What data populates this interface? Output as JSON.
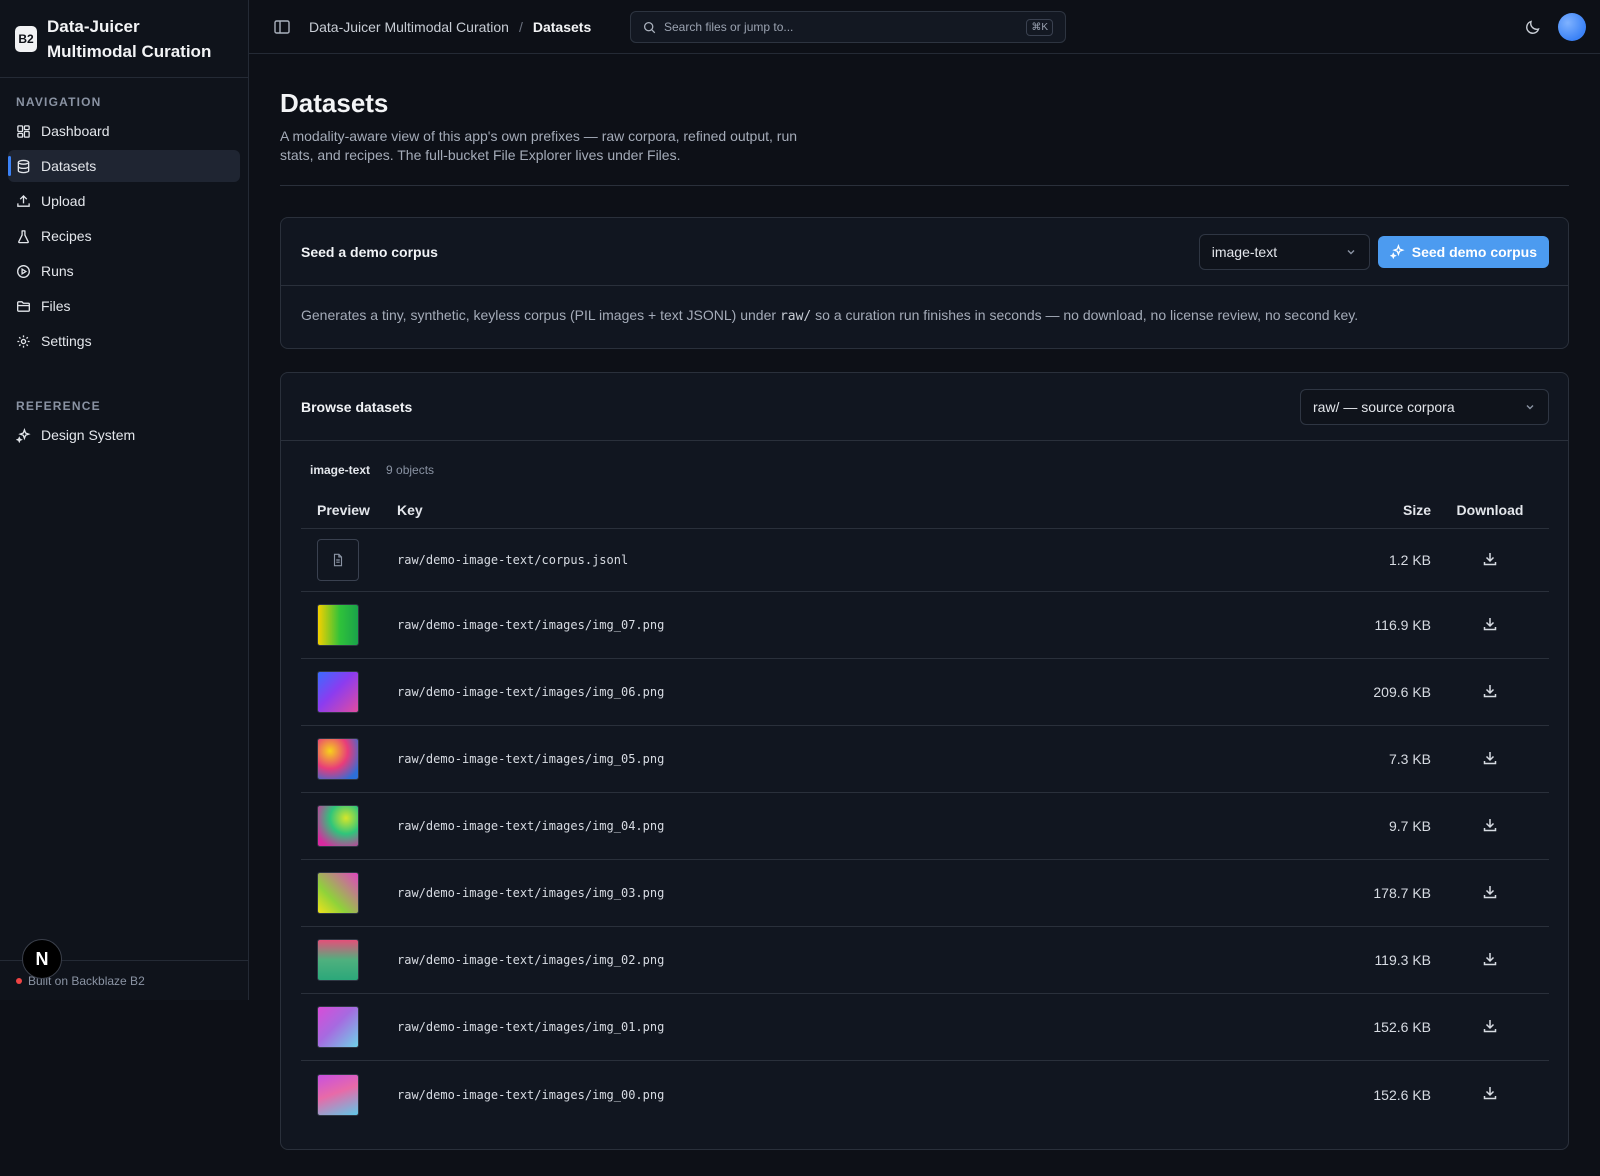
{
  "app": {
    "logo_text": "B2",
    "title": "Data-Juicer Multimodal Curation"
  },
  "sidebar": {
    "nav_label": "NAVIGATION",
    "items": [
      {
        "label": "Dashboard",
        "icon": "dashboard-icon"
      },
      {
        "label": "Datasets",
        "icon": "database-icon",
        "active": true
      },
      {
        "label": "Upload",
        "icon": "upload-icon"
      },
      {
        "label": "Recipes",
        "icon": "flask-icon"
      },
      {
        "label": "Runs",
        "icon": "play-circle-icon"
      },
      {
        "label": "Files",
        "icon": "folder-icon"
      },
      {
        "label": "Settings",
        "icon": "gear-icon"
      }
    ],
    "reference_label": "REFERENCE",
    "reference_items": [
      {
        "label": "Design System",
        "icon": "sparkles-icon"
      }
    ],
    "footer": "Built on Backblaze B2",
    "badge": "N"
  },
  "topbar": {
    "breadcrumb_root": "Data-Juicer Multimodal Curation",
    "breadcrumb_sep": "/",
    "breadcrumb_current": "Datasets",
    "search_placeholder": "Search files or jump to...",
    "search_shortcut": "⌘K"
  },
  "page": {
    "title": "Datasets",
    "description": "A modality-aware view of this app's own prefixes — raw corpora, refined output, run stats, and recipes. The full-bucket File Explorer lives under Files."
  },
  "seed_card": {
    "title": "Seed a demo corpus",
    "select_value": "image-text",
    "button_label": "Seed demo corpus",
    "desc_before": "Generates a tiny, synthetic, keyless corpus (PIL images + text JSONL) under ",
    "desc_code": "raw/",
    "desc_after": " so a curation run finishes in seconds — no download, no license review, no second key."
  },
  "browse_card": {
    "title": "Browse datasets",
    "select_value": "raw/ — source corpora",
    "group_name": "image-text",
    "group_count": "9 objects",
    "columns": {
      "preview": "Preview",
      "key": "Key",
      "size": "Size",
      "download": "Download"
    },
    "rows": [
      {
        "key": "raw/demo-image-text/corpus.jsonl",
        "size": "1.2 KB",
        "type": "file"
      },
      {
        "key": "raw/demo-image-text/images/img_07.png",
        "size": "116.9 KB",
        "type": "image",
        "thumb": "linear-gradient(90deg,#f5d000,#2fc23a 55%,#1aa24a)"
      },
      {
        "key": "raw/demo-image-text/images/img_06.png",
        "size": "209.6 KB",
        "type": "image",
        "thumb": "linear-gradient(135deg,#3b6bff,#8b3cf0 45%,#e24ca0)"
      },
      {
        "key": "raw/demo-image-text/images/img_05.png",
        "size": "7.3 KB",
        "type": "image",
        "thumb": "radial-gradient(circle at 30% 30%,#f7d21a,#e83c7a 45%,#2c6fd8 85%)"
      },
      {
        "key": "raw/demo-image-text/images/img_04.png",
        "size": "9.7 KB",
        "type": "image",
        "thumb": "radial-gradient(circle at 70% 30%,#d6e62a,#2fc57b 40%,#d82aa0 85%)"
      },
      {
        "key": "raw/demo-image-text/images/img_03.png",
        "size": "178.7 KB",
        "type": "image",
        "thumb": "linear-gradient(45deg,#f0e21b,#8fd23a 35%,#e046c0)"
      },
      {
        "key": "raw/demo-image-text/images/img_02.png",
        "size": "119.3 KB",
        "type": "image",
        "thumb": "linear-gradient(180deg,#e4507a,#4fb07e 50%,#2ba87a)"
      },
      {
        "key": "raw/demo-image-text/images/img_01.png",
        "size": "152.6 KB",
        "type": "image",
        "thumb": "linear-gradient(135deg,#d84cd8,#a66ae0 45%,#6fd2e8)"
      },
      {
        "key": "raw/demo-image-text/images/img_00.png",
        "size": "152.6 KB",
        "type": "image",
        "thumb": "linear-gradient(160deg,#c850e0,#e86aa8 45%,#5fc8e8)"
      }
    ]
  },
  "colors": {
    "accent": "#4c9bf0",
    "active_indicator": "#3b82f6",
    "background": "#0d1017",
    "status_dot": "#ef4444"
  }
}
